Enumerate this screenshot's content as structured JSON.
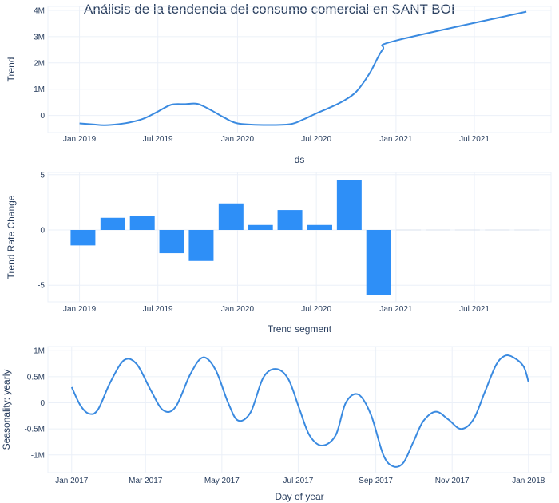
{
  "title": "Análisis de la tendencia del consumo comercial en SANT BOI",
  "colors": {
    "line": "#3a8ae0",
    "bar": "#2e8ff7",
    "grid": "#ebf0f8",
    "text": "#2a3f5f"
  },
  "chart_data": [
    {
      "type": "line",
      "title": "Análisis de la tendencia del consumo comercial en SANT BOI",
      "xlabel": "ds",
      "ylabel": "Trend",
      "x_ticks": [
        "Jan 2019",
        "Jul 2019",
        "Jan 2020",
        "Jul 2020",
        "Jan 2021",
        "Jul 2021"
      ],
      "y_ticks": [
        "0",
        "1M",
        "2M",
        "3M",
        "4M"
      ],
      "xlim": [
        "2018-10-20",
        "2021-12-25"
      ],
      "ylim": [
        -650000,
        4150000
      ],
      "grid": true,
      "series": [
        {
          "x": [
            "2019-01-01",
            "2019-02-01",
            "2019-03-01",
            "2019-04-01",
            "2019-05-01",
            "2019-06-01",
            "2019-07-01",
            "2019-08-01",
            "2019-09-01",
            "2019-10-01",
            "2019-11-01",
            "2019-12-01",
            "2020-01-01",
            "2020-03-01",
            "2020-05-01",
            "2020-06-01",
            "2020-07-01",
            "2020-08-01",
            "2020-09-01",
            "2020-10-01",
            "2020-11-01",
            "2020-12-01",
            "2021-01-01",
            "2021-10-29"
          ],
          "y": [
            -300000,
            -340000,
            -370000,
            -330000,
            -250000,
            -100000,
            150000,
            410000,
            430000,
            440000,
            200000,
            -80000,
            -300000,
            -360000,
            -330000,
            -150000,
            80000,
            300000,
            550000,
            900000,
            1600000,
            2500000,
            2850000,
            3950000
          ]
        }
      ]
    },
    {
      "type": "bar",
      "xlabel": "Trend segment",
      "ylabel": "Trend Rate Change",
      "x_ticks": [
        "Jan 2019",
        "Jul 2019",
        "Jan 2020",
        "Jul 2020",
        "Jan 2021",
        "Jul 2021"
      ],
      "y_ticks": [
        "-5",
        "0",
        "5"
      ],
      "xlim": [
        "2018-10-20",
        "2021-12-25"
      ],
      "ylim": [
        -6.5,
        5.2
      ],
      "grid": true,
      "x": [
        "2019-01-09",
        "2019-03-19",
        "2019-05-26",
        "2019-08-02",
        "2019-10-09",
        "2019-12-17",
        "2020-02-23",
        "2020-05-01",
        "2020-07-09",
        "2020-09-15",
        "2020-11-22",
        "2021-01-30",
        "2021-04-08",
        "2021-06-15",
        "2021-08-23",
        "2021-10-30"
      ],
      "values": [
        -1.4,
        1.1,
        1.3,
        -2.1,
        -2.8,
        2.4,
        0.45,
        1.8,
        0.45,
        4.5,
        -5.9,
        0,
        0,
        0,
        0,
        0
      ]
    },
    {
      "type": "line",
      "xlabel": "Day of year",
      "ylabel": "Seasonality: yearly",
      "x_ticks": [
        "Jan 2017",
        "Mar 2017",
        "May 2017",
        "Jul 2017",
        "Sep 2017",
        "Nov 2017",
        "Jan 2018"
      ],
      "y_ticks": [
        "-1M",
        "-0.5M",
        "0",
        "0.5M",
        "1M"
      ],
      "xlim": [
        "2016-12-13",
        "2018-01-19"
      ],
      "ylim": [
        -1340000,
        1080000
      ],
      "grid": true,
      "series": [
        {
          "x": [
            "2017-01-01",
            "2017-01-08",
            "2017-01-15",
            "2017-01-22",
            "2017-02-01",
            "2017-02-12",
            "2017-02-22",
            "2017-03-05",
            "2017-03-15",
            "2017-03-25",
            "2017-04-06",
            "2017-04-16",
            "2017-04-26",
            "2017-05-06",
            "2017-05-14",
            "2017-05-24",
            "2017-06-03",
            "2017-06-13",
            "2017-06-23",
            "2017-07-02",
            "2017-07-10",
            "2017-07-20",
            "2017-07-31",
            "2017-08-08",
            "2017-08-18",
            "2017-08-28",
            "2017-09-07",
            "2017-09-15",
            "2017-09-23",
            "2017-10-01",
            "2017-10-09",
            "2017-10-19",
            "2017-10-29",
            "2017-11-08",
            "2017-11-18",
            "2017-11-27",
            "2017-12-06",
            "2017-12-13",
            "2017-12-20",
            "2017-12-28",
            "2018-01-01"
          ],
          "y": [
            300000,
            -50000,
            -210000,
            -130000,
            400000,
            820000,
            740000,
            250000,
            -140000,
            -80000,
            560000,
            870000,
            630000,
            0,
            -340000,
            -180000,
            480000,
            650000,
            460000,
            -120000,
            -620000,
            -820000,
            -620000,
            0,
            160000,
            -220000,
            -1000000,
            -1220000,
            -1150000,
            -750000,
            -350000,
            -170000,
            -320000,
            -500000,
            -320000,
            200000,
            720000,
            900000,
            870000,
            700000,
            400000
          ]
        }
      ]
    }
  ]
}
